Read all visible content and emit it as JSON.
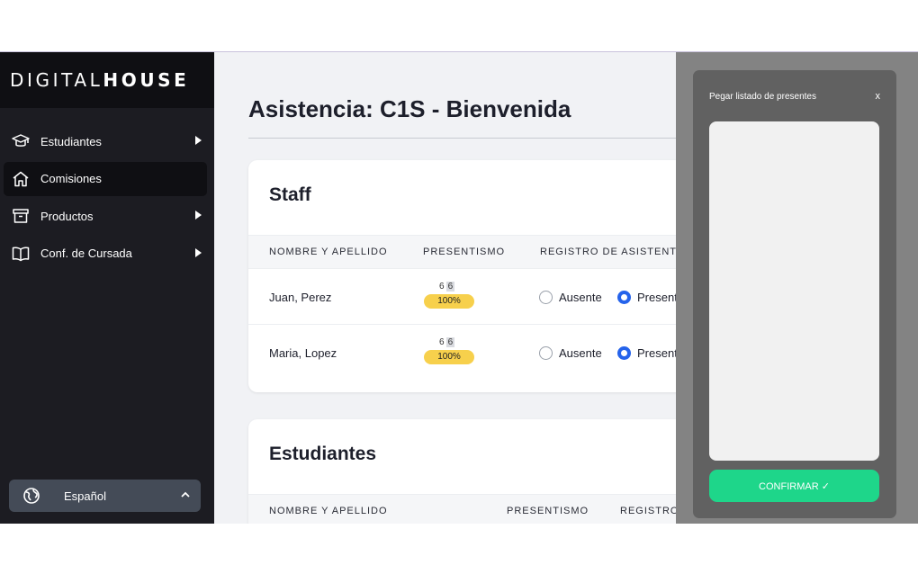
{
  "brand": {
    "logo_light": "DIGITAL",
    "logo_bold": "HOUSE"
  },
  "sidebar": {
    "items": [
      {
        "label": "Estudiantes",
        "icon": "graduation-cap-icon",
        "has_submenu": true,
        "active": false
      },
      {
        "label": "Comisiones",
        "icon": "home-icon",
        "has_submenu": false,
        "active": true
      },
      {
        "label": "Productos",
        "icon": "archive-box-icon",
        "has_submenu": true,
        "active": false
      },
      {
        "label": "Conf. de Cursada",
        "icon": "book-open-icon",
        "has_submenu": true,
        "active": false
      }
    ],
    "language": {
      "label": "Español",
      "icon": "globe-icon"
    }
  },
  "main": {
    "title": "Asistencia: C1S - Bienvenida",
    "staff": {
      "title": "Staff",
      "columns": [
        "NOMBRE Y APELLIDO",
        "PRESENTISMO",
        "REGISTRO DE ASISTENTES"
      ],
      "rows": [
        {
          "name": "Juan, Perez",
          "attended": "6",
          "total": "6",
          "percent": "100%",
          "absent_label": "Ausente",
          "present_label": "Presente",
          "selected": "present"
        },
        {
          "name": "Maria, Lopez",
          "attended": "6",
          "total": "6",
          "percent": "100%",
          "absent_label": "Ausente",
          "present_label": "Presente",
          "selected": "present"
        }
      ]
    },
    "students": {
      "title": "Estudiantes",
      "columns": [
        "NOMBRE Y APELLIDO",
        "PRESENTISMO",
        "REGISTRO"
      ]
    }
  },
  "dialog": {
    "title": "Pegar listado de presentes",
    "close_label": "x",
    "textarea_value": "",
    "confirm_label": "CONFIRMAR ✓"
  },
  "colors": {
    "sidebar_bg": "#1c1c22",
    "accent_blue": "#2563eb",
    "badge_yellow": "#f7d04c",
    "confirm_green": "#1ed68a",
    "overlay_gray": "#838383"
  }
}
